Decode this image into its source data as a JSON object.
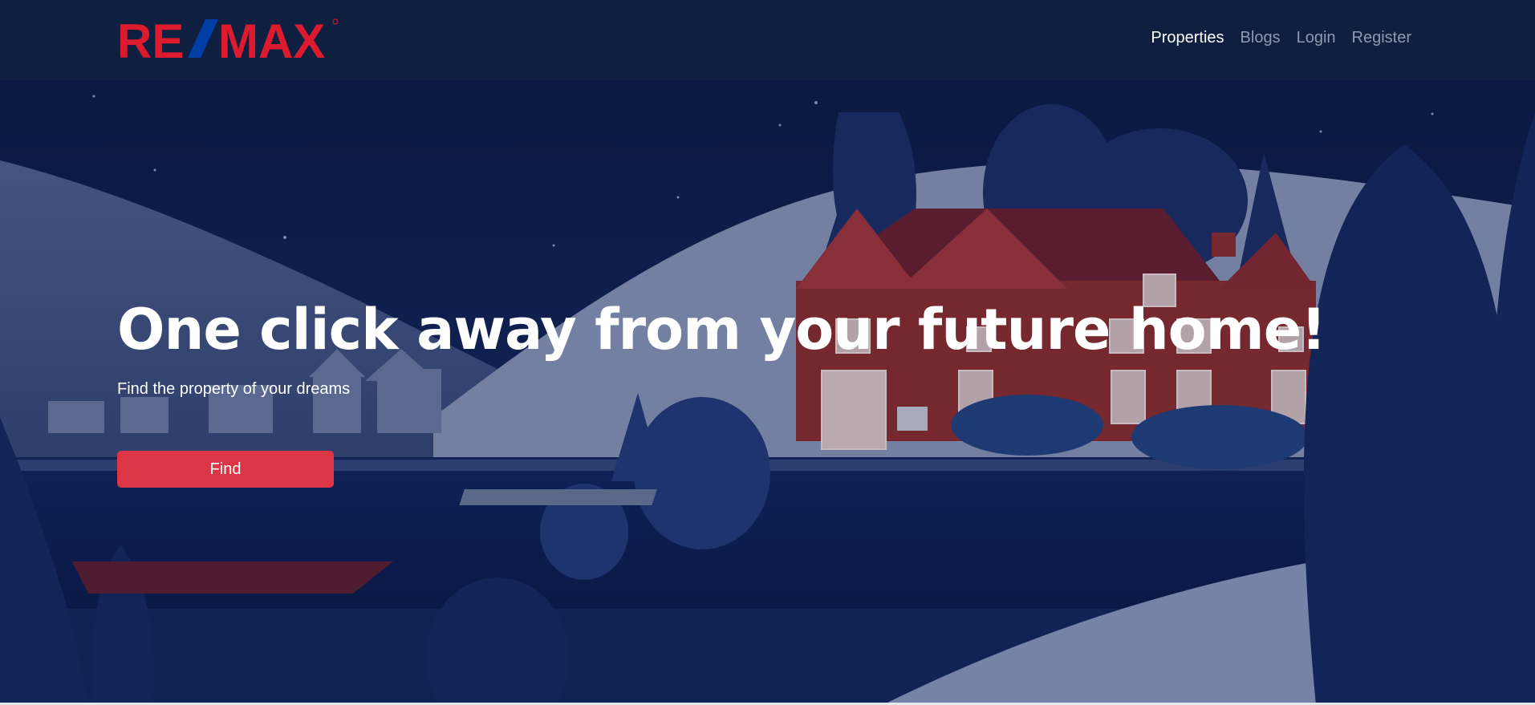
{
  "brand": {
    "logo_text": "RE/MAX",
    "colors": {
      "red": "#dc1c2e",
      "blue": "#003da5"
    }
  },
  "nav": {
    "items": [
      {
        "label": "Properties",
        "active": true
      },
      {
        "label": "Blogs",
        "active": false
      },
      {
        "label": "Login",
        "active": false
      },
      {
        "label": "Register",
        "active": false
      }
    ]
  },
  "hero": {
    "title": "One click away from your future home!",
    "subtitle": "Find the property of your dreams",
    "button_label": "Find",
    "button_color": "#dc3545",
    "background": "night-house-landscape-illustration"
  }
}
